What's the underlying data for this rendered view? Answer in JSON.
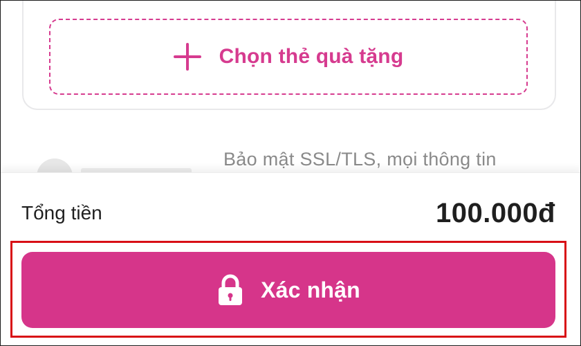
{
  "gift_card": {
    "label": "Chọn thẻ quà tặng",
    "icon": "plus-icon"
  },
  "security": {
    "text": "Bảo mật SSL/TLS, mọi thông tin"
  },
  "total": {
    "label": "Tổng tiền",
    "value": "100.000đ"
  },
  "confirm": {
    "label": "Xác nhận",
    "icon": "lock-icon"
  },
  "colors": {
    "accent": "#d6358a",
    "highlight_border": "#d80f16",
    "text": "#1f1f1f",
    "muted_text": "#8a8a8a"
  }
}
